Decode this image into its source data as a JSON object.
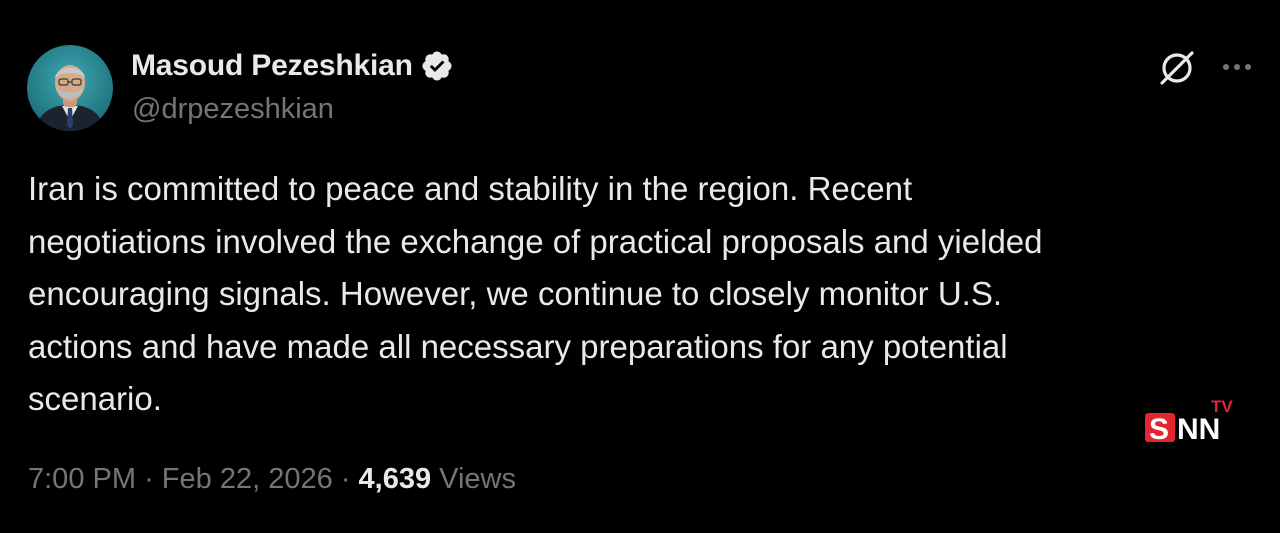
{
  "author": {
    "display_name": "Masoud Pezeshkian",
    "handle": "@drpezeshkian",
    "verified": true,
    "avatar": "avatar-photo"
  },
  "header_icons": {
    "grok": "grok-icon",
    "more": "more-icon",
    "verified_color": "#e7e9ea"
  },
  "body_lines": [
    "Iran is committed to peace and stability in the region. Recent",
    "negotiations involved the exchange of practical proposals and yielded",
    "encouraging signals. However, we continue to closely monitor U.S.",
    "actions and have made all necessary preparations for any potential",
    "scenario."
  ],
  "meta": {
    "time": "7:00 PM",
    "separator": "·",
    "date": "Feb 22, 2026",
    "views_count": "4,639",
    "views_label": "Views"
  },
  "watermark": {
    "brand": "SNN",
    "sub": "TV",
    "accent_color": "#e3262f"
  },
  "colors": {
    "background": "#000000",
    "primary_text": "#e7e9ea",
    "secondary_text": "#71767b"
  }
}
